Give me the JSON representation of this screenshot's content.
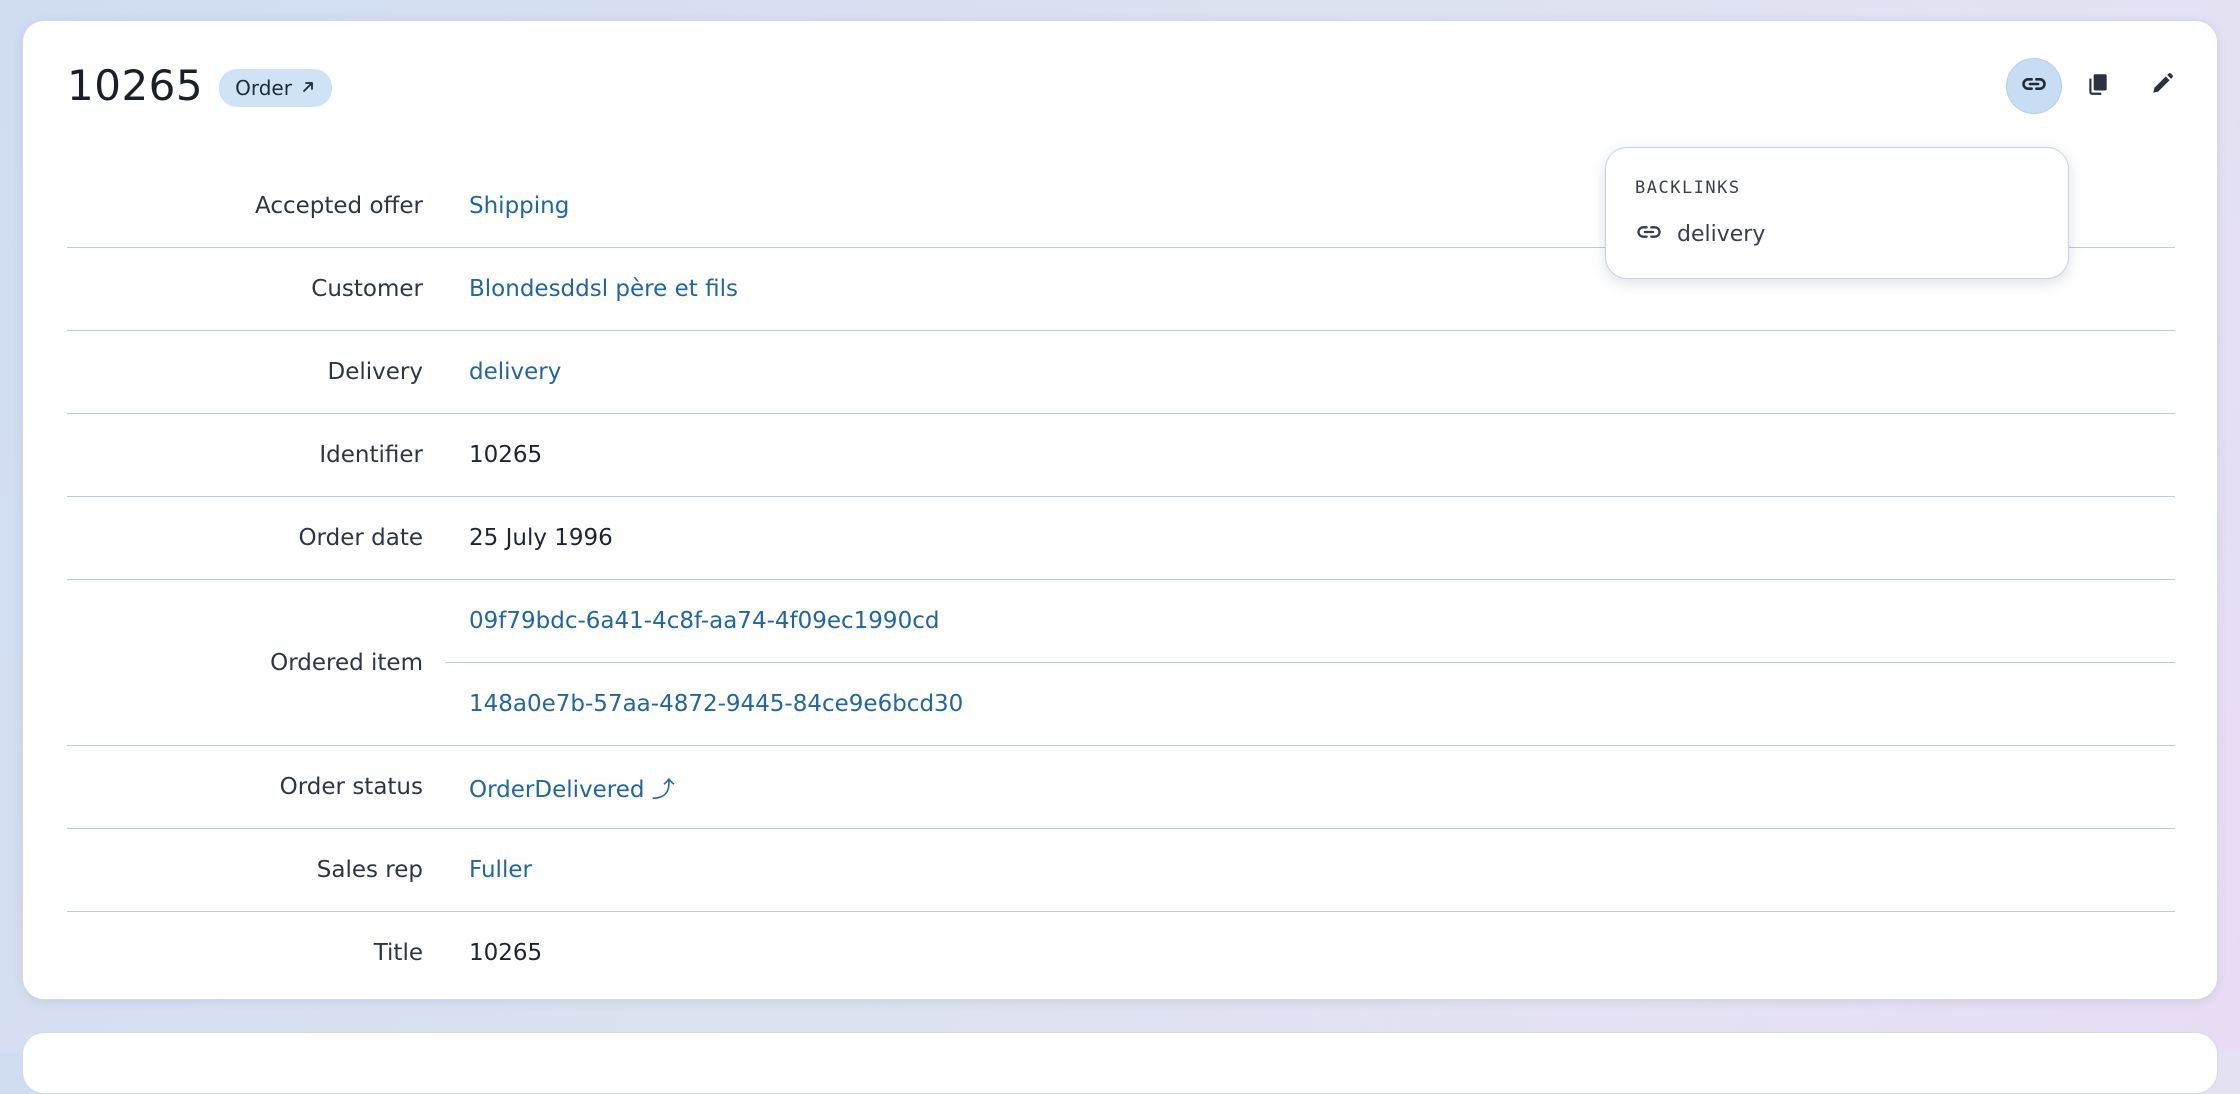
{
  "record": {
    "title": "10265",
    "type_label": "Order",
    "type_icon": "arrow-up-right-icon"
  },
  "actions": [
    {
      "name": "backlinks",
      "icon": "link-icon",
      "active": true
    },
    {
      "name": "copy",
      "icon": "copy-icon",
      "active": false
    },
    {
      "name": "edit",
      "icon": "pencil-icon",
      "active": false
    }
  ],
  "fields": {
    "accepted_offer": {
      "label": "Accepted offer",
      "value": "Shipping"
    },
    "customer": {
      "label": "Customer",
      "value": "Blondesddsl père et fils"
    },
    "delivery": {
      "label": "Delivery",
      "value": "delivery"
    },
    "identifier": {
      "label": "Identifier",
      "value": "10265"
    },
    "order_date": {
      "label": "Order date",
      "value": "25 July 1996"
    },
    "ordered_item": {
      "label": "Ordered item",
      "values": [
        "09f79bdc-6a41-4c8f-aa74-4f09ec1990cd",
        "148a0e7b-57aa-4872-9445-84ce9e6bcd30"
      ]
    },
    "order_status": {
      "label": "Order status",
      "value": "OrderDelivered ⤴"
    },
    "sales_rep": {
      "label": "Sales rep",
      "value": "Fuller"
    },
    "title": {
      "label": "Title",
      "value": "10265"
    }
  },
  "backlinks_popover": {
    "heading": "BACKLINKS",
    "items": [
      {
        "label": "delivery",
        "icon": "link-icon"
      }
    ]
  },
  "colors": {
    "link": "#2166a3",
    "badge_bg": "#cfe3f7",
    "active_button_bg": "#c6ddf3",
    "divider": "#b9cde0"
  }
}
